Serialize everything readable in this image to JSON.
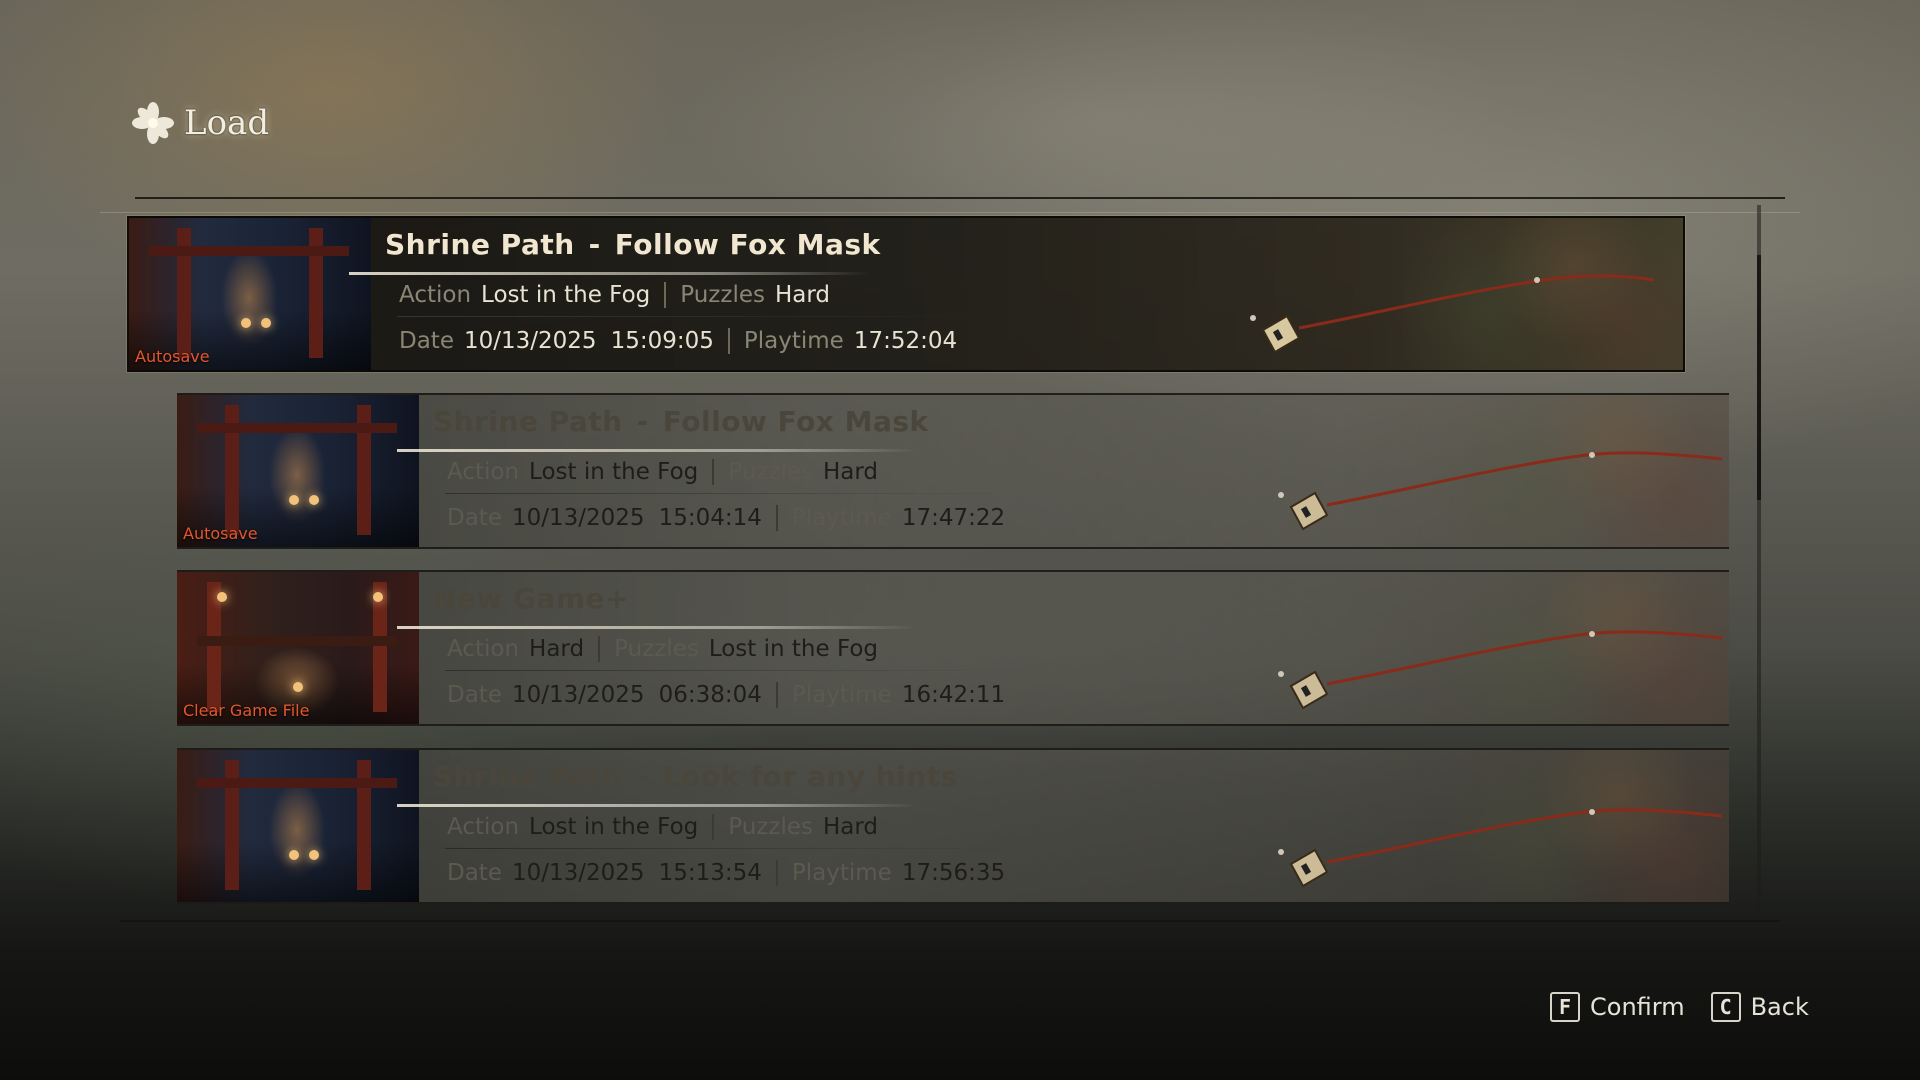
{
  "header": {
    "title": "Load"
  },
  "slots": [
    {
      "tag": "Autosave",
      "chapter": "Shrine Path",
      "objective": "Follow Fox Mask",
      "heading_separator": "-",
      "action_label": "Action",
      "action_value": "Lost in the Fog",
      "puzzles_label": "Puzzles",
      "puzzles_value": "Hard",
      "date_label": "Date",
      "date": "10/13/2025",
      "time": "15:09:05",
      "playtime_label": "Playtime",
      "playtime": "17:52:04",
      "selected": true
    },
    {
      "tag": "Autosave",
      "chapter": "Shrine Path",
      "objective": "Follow Fox Mask",
      "heading_separator": "-",
      "action_label": "Action",
      "action_value": "Lost in the Fog",
      "puzzles_label": "Puzzles",
      "puzzles_value": "Hard",
      "date_label": "Date",
      "date": "10/13/2025",
      "time": "15:04:14",
      "playtime_label": "Playtime",
      "playtime": "17:47:22",
      "selected": false
    },
    {
      "tag": "Clear Game File",
      "chapter": "New Game+",
      "objective": "",
      "heading_separator": "",
      "action_label": "Action",
      "action_value": "Hard",
      "puzzles_label": "Puzzles",
      "puzzles_value": "Lost in the Fog",
      "date_label": "Date",
      "date": "10/13/2025",
      "time": "06:38:04",
      "playtime_label": "Playtime",
      "playtime": "16:42:11",
      "selected": false
    },
    {
      "tag": "",
      "chapter": "Shrine Path",
      "objective": "Look for any hints",
      "heading_separator": "-",
      "action_label": "Action",
      "action_value": "Lost in the Fog",
      "puzzles_label": "Puzzles",
      "puzzles_value": "Hard",
      "date_label": "Date",
      "date": "10/13/2025",
      "time": "15:13:54",
      "playtime_label": "Playtime",
      "playtime": "17:56:35",
      "selected": false
    }
  ],
  "prompts": {
    "confirm_key": "F",
    "confirm_label": "Confirm",
    "back_key": "C",
    "back_label": "Back"
  },
  "colors": {
    "accent_tag": "#e4572e",
    "cord": "#8a2a1a"
  },
  "icons": {
    "title": "flower-icon",
    "slot": "fox-mask-icon"
  }
}
